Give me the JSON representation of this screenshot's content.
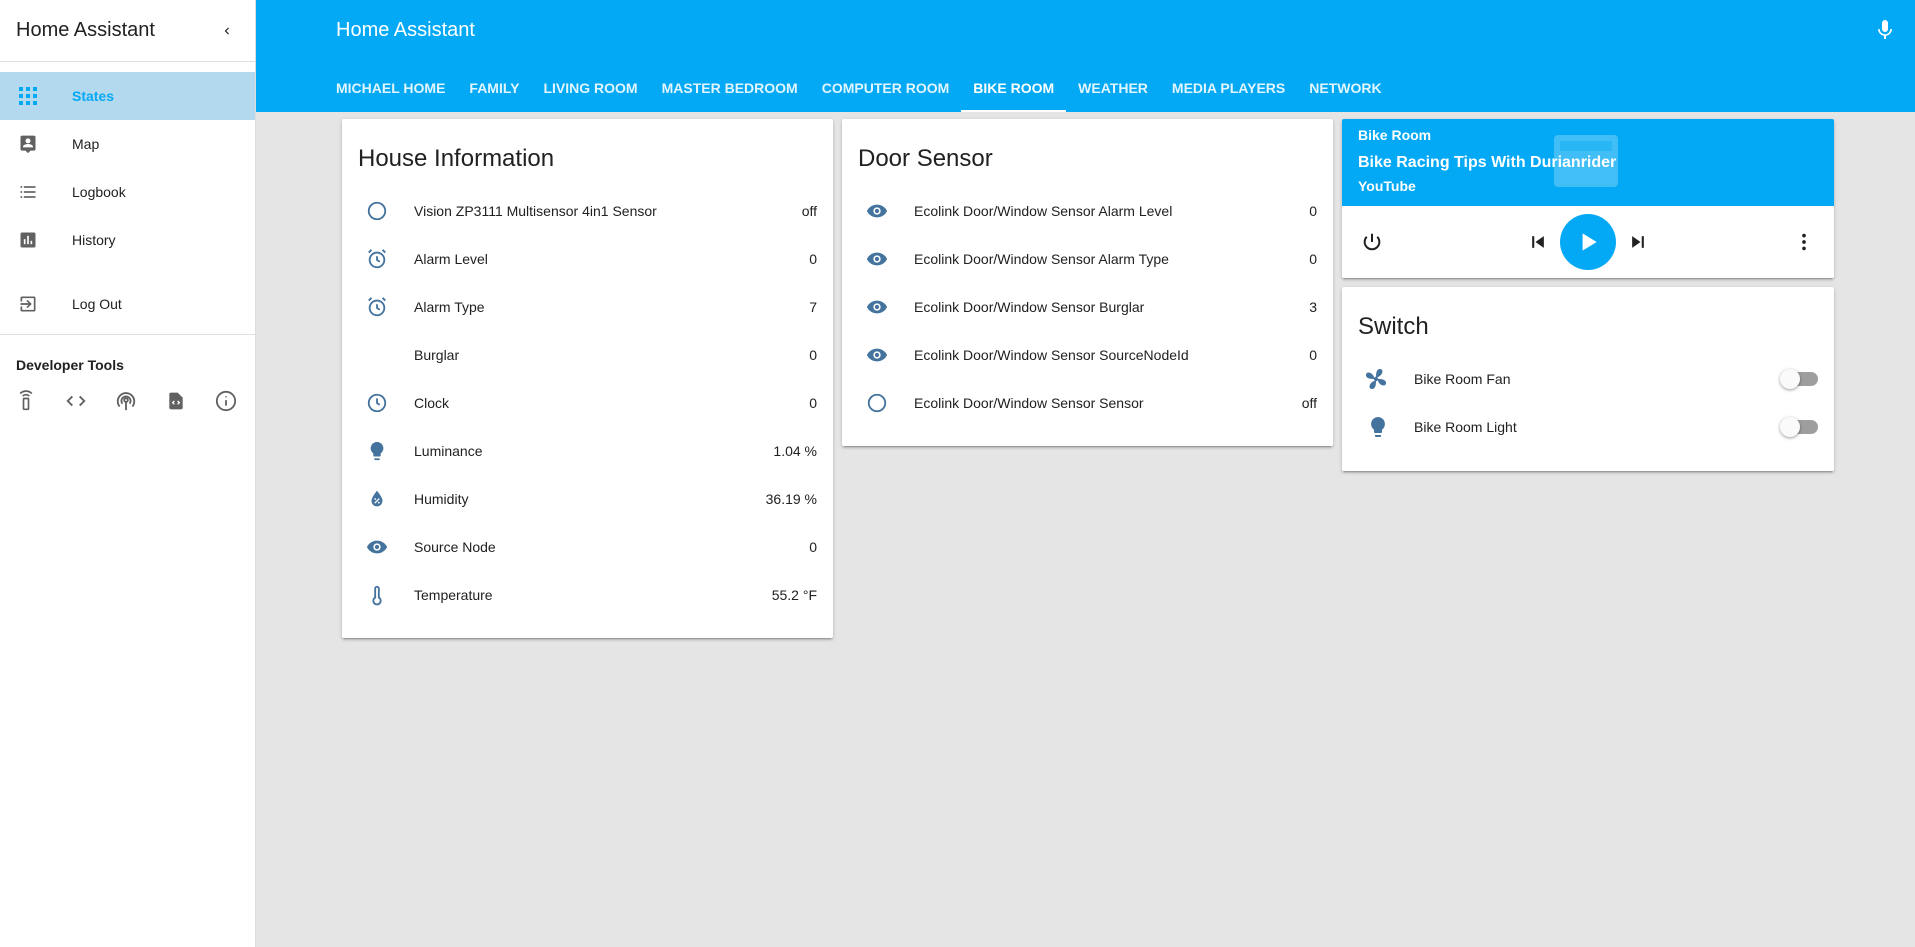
{
  "sidebar": {
    "title": "Home Assistant",
    "items": [
      {
        "label": "States",
        "icon": "grid-icon",
        "active": true
      },
      {
        "label": "Map",
        "icon": "map-icon"
      },
      {
        "label": "Logbook",
        "icon": "logbook-icon"
      },
      {
        "label": "History",
        "icon": "history-icon"
      }
    ],
    "logout_label": "Log Out",
    "dev_tools_title": "Developer Tools",
    "dev_tools": [
      "remote-icon",
      "code-icon",
      "broadcast-icon",
      "template-icon",
      "info-icon"
    ]
  },
  "topbar": {
    "title": "Home Assistant",
    "tabs": [
      "MICHAEL HOME",
      "FAMILY",
      "LIVING ROOM",
      "MASTER BEDROOM",
      "COMPUTER ROOM",
      "BIKE ROOM",
      "WEATHER",
      "MEDIA PLAYERS",
      "NETWORK"
    ],
    "active_tab": "BIKE ROOM",
    "accent": "#03a9f4"
  },
  "house_info": {
    "title": "House Information",
    "rows": [
      {
        "icon": "circle-outline-icon",
        "name": "Vision ZP3111 Multisensor 4in1 Sensor",
        "value": "off"
      },
      {
        "icon": "alarm-icon",
        "name": "Alarm Level",
        "value": "0"
      },
      {
        "icon": "alarm-icon",
        "name": "Alarm Type",
        "value": "7"
      },
      {
        "icon": "",
        "name": "Burglar",
        "value": "0"
      },
      {
        "icon": "clock-icon",
        "name": "Clock",
        "value": "0"
      },
      {
        "icon": "lightbulb-icon",
        "name": "Luminance",
        "value": "1.04 %"
      },
      {
        "icon": "water-percent-icon",
        "name": "Humidity",
        "value": "36.19 %"
      },
      {
        "icon": "eye-icon",
        "name": "Source Node",
        "value": "0"
      },
      {
        "icon": "thermometer-icon",
        "name": "Temperature",
        "value": "55.2 °F"
      }
    ]
  },
  "door_sensor": {
    "title": "Door Sensor",
    "rows": [
      {
        "icon": "eye-icon",
        "name": "Ecolink Door/Window Sensor Alarm Level",
        "value": "0"
      },
      {
        "icon": "eye-icon",
        "name": "Ecolink Door/Window Sensor Alarm Type",
        "value": "0"
      },
      {
        "icon": "eye-icon",
        "name": "Ecolink Door/Window Sensor Burglar",
        "value": "3"
      },
      {
        "icon": "eye-icon",
        "name": "Ecolink Door/Window Sensor SourceNodeId",
        "value": "0"
      },
      {
        "icon": "circle-outline-icon",
        "name": "Ecolink Door/Window Sensor Sensor",
        "value": "off"
      }
    ]
  },
  "media": {
    "room": "Bike Room",
    "title": "Bike Racing Tips With Durianrider",
    "source": "YouTube"
  },
  "switch_card": {
    "title": "Switch",
    "rows": [
      {
        "icon": "fan-icon",
        "name": "Bike Room Fan",
        "on": false
      },
      {
        "icon": "lightbulb-icon",
        "name": "Bike Room Light",
        "on": false
      }
    ]
  }
}
